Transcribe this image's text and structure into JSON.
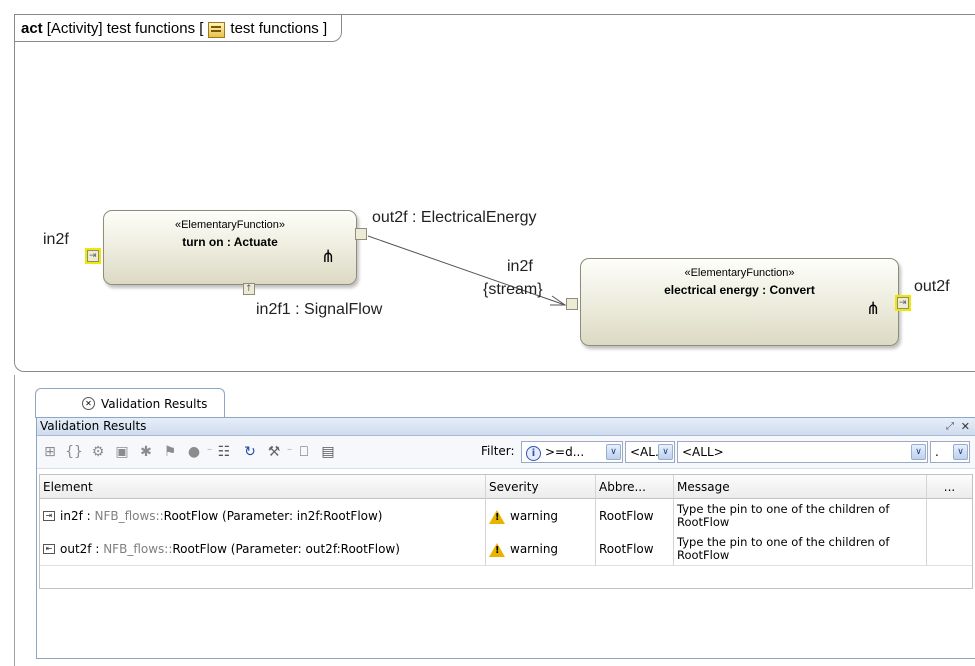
{
  "diagram": {
    "keyword": "act",
    "frame_title_before": "[Activity] test functions [",
    "frame_title_after": "test functions ]",
    "action1": {
      "stereotype": "«ElementaryFunction»",
      "name": "turn on : Actuate"
    },
    "action2": {
      "stereotype": "«ElementaryFunction»",
      "name": "electrical energy : Convert"
    },
    "labels": {
      "in2f_left": "in2f",
      "out2f_action1": "out2f : ElectricalEnergy",
      "in2f1": "in2f1 : SignalFlow",
      "in2f_action2": "in2f",
      "stream": "{stream}",
      "out2f_right": "out2f"
    }
  },
  "panel": {
    "tab_label": "Validation Results",
    "title": "Validation Results",
    "filter_label": "Filter:",
    "filters": {
      "severity": ">=d...",
      "abbrev": "<AL...",
      "all": "<ALL>",
      "extra": "."
    },
    "columns": [
      "Element",
      "Severity",
      "Abbre...",
      "Message",
      "..."
    ],
    "rows": [
      {
        "icon": "pin-in-icon",
        "name": "in2f :",
        "pkg": "NFB_flows::",
        "detail": "RootFlow (Parameter: in2f:RootFlow)",
        "severity": "warning",
        "abbrev": "RootFlow",
        "message": "Type the pin to one of the children of RootFlow"
      },
      {
        "icon": "pin-out-icon",
        "name": "out2f :",
        "pkg": "NFB_flows::",
        "detail": "RootFlow (Parameter: out2f:RootFlow)",
        "severity": "warning",
        "abbrev": "RootFlow",
        "message": "Type the pin to one of the children of RootFlow"
      }
    ]
  }
}
